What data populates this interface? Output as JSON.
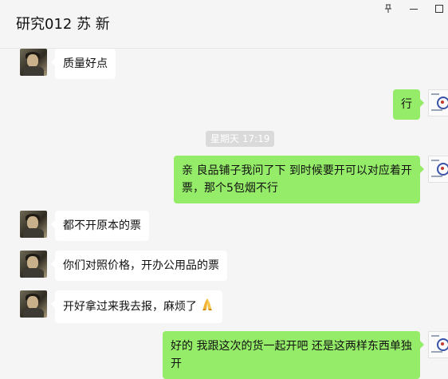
{
  "window": {
    "title": "研究012 苏 新",
    "pin_glyph": "⊥"
  },
  "timestamp": "星期天 17:19",
  "messages": [
    {
      "side": "in",
      "text": "质量好点"
    },
    {
      "side": "out",
      "text": "行"
    },
    {
      "side": "out",
      "text": "亲 良品铺子我问了下 到时候要开可以对应着开票，那个5包烟不行"
    },
    {
      "side": "in",
      "text": "都不开原本的票"
    },
    {
      "side": "in",
      "text": "你们对照价格，开办公用品的票"
    },
    {
      "side": "in",
      "text": "开好拿过来我去报，麻烦了"
    },
    {
      "side": "out",
      "text": "好的 我跟这次的货一起开吧 还是这两样东西单独开"
    }
  ],
  "icons": {
    "window_pin": "pin-icon",
    "window_minimize": "minimize-icon",
    "window_maximize": "maximize-icon",
    "emoji_hands": "folded-hands-emoji"
  },
  "colors": {
    "background": "#f5f5f5",
    "incoming_bubble": "#ffffff",
    "outgoing_bubble": "#95ec69",
    "timestamp_bg": "#dadada"
  }
}
